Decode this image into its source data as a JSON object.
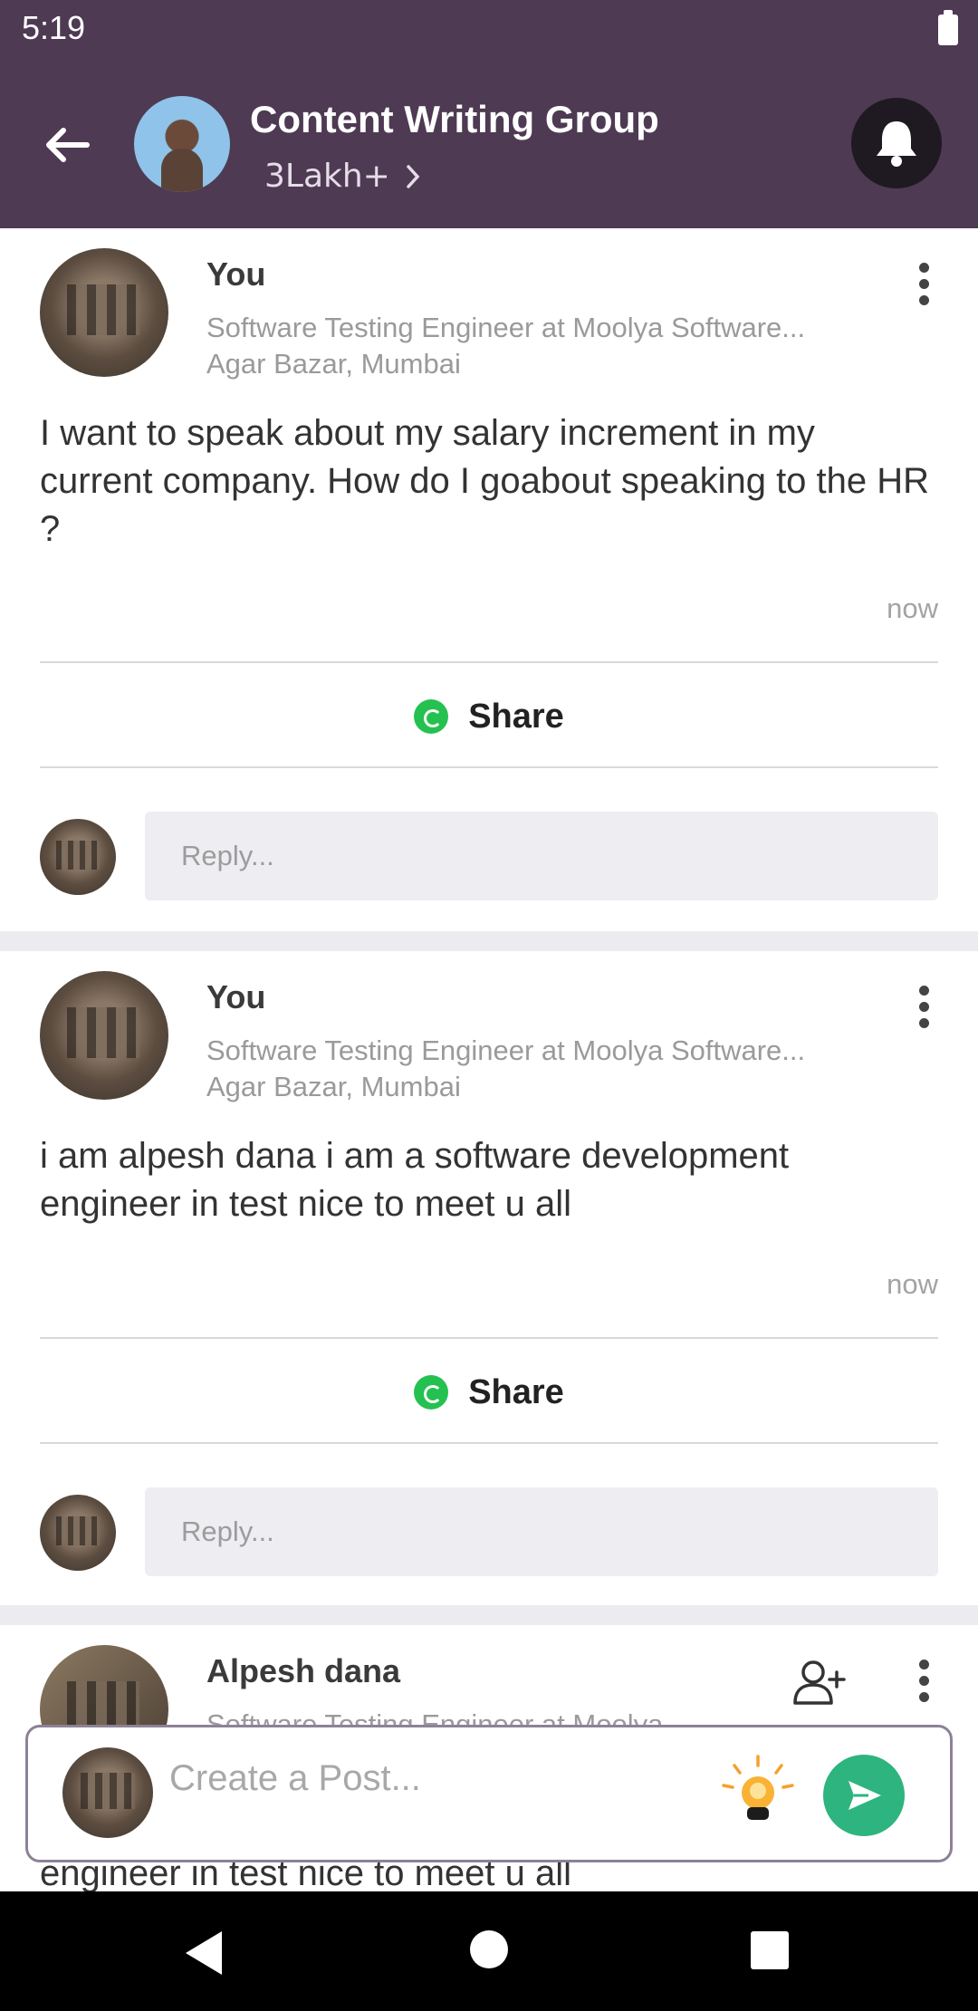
{
  "status_bar": {
    "time": "5:19"
  },
  "header": {
    "group_title": "Content Writing Group",
    "members": "3Lakh+"
  },
  "posts": [
    {
      "author": "You",
      "role": "Software Testing Engineer at Moolya Software...",
      "location": "Agar Bazar, Mumbai",
      "text": "I want to speak about my salary increment in my current company. How do I goabout speaking to the HR ?",
      "time": "now",
      "share_label": "Share",
      "reply_placeholder": "Reply..."
    },
    {
      "author": "You",
      "role": "Software Testing Engineer at Moolya Software...",
      "location": "Agar Bazar, Mumbai",
      "text": "i am alpesh dana i am a software development engineer in test nice to meet u all",
      "time": "now",
      "share_label": "Share",
      "reply_placeholder": "Reply..."
    },
    {
      "author": "Alpesh dana",
      "role": "Software Testing Engineer at Moolya...",
      "text_peek": "engineer in test nice to meet u all"
    }
  ],
  "composer": {
    "placeholder": "Create a Post..."
  }
}
